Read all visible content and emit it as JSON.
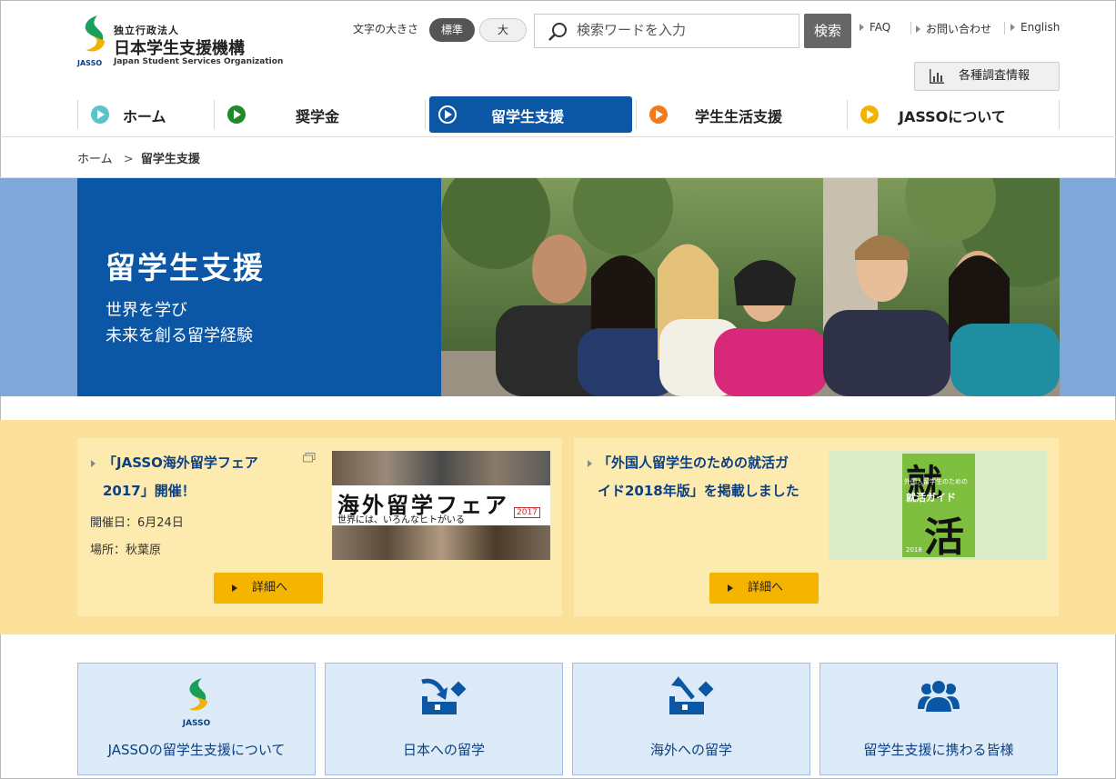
{
  "header": {
    "logo": {
      "line1": "独立行政法人",
      "line2": "日本学生支援機構",
      "line3": "Japan Student Services Organization",
      "mark_text": "JASSO"
    },
    "font_size_label": "文字の大きさ",
    "font_size_normal": "標準",
    "font_size_large": "大",
    "search_placeholder": "検索ワードを入力",
    "search_button": "検索",
    "links": [
      "FAQ",
      "お問い合わせ",
      "English"
    ],
    "survey_button": "各種調査情報"
  },
  "nav": {
    "items": [
      {
        "label": "ホーム",
        "color": "#5bc3c7"
      },
      {
        "label": "奨学金",
        "color": "#1e8a2c"
      },
      {
        "label": "留学生支援",
        "color": "#0c56a6"
      },
      {
        "label": "学生生活支援",
        "color": "#f07a1c"
      },
      {
        "label": "JASSOについて",
        "color": "#f2b200"
      }
    ]
  },
  "breadcrumb": {
    "home": "ホーム",
    "separator": ">",
    "current": "留学生支援"
  },
  "hero": {
    "title": "留学生支援",
    "subtitle_line1": "世界を学び",
    "subtitle_line2": "未来を創る留学経験"
  },
  "news": [
    {
      "title_line1": "「JASSO海外留学フェア",
      "title_line2": "2017」開催！",
      "date": "開催日：6月24日",
      "place": "場所：秋葉原",
      "button": "詳細へ",
      "image_text": "海外留学フェア",
      "image_sub": "世界には、いろんなヒトがいる",
      "image_year": "2017"
    },
    {
      "title_line1": "「外国人留学生のための就活ガ",
      "title_line2": "イド2018年版」を掲載しました",
      "button": "詳細へ",
      "image_big1": "就",
      "image_mid": "就活ガイド",
      "image_big2": "活",
      "image_small": "外国人留学生のための",
      "image_year": "2018"
    }
  ],
  "tiles": [
    {
      "label": "JASSOの留学生支援について",
      "icon": "jasso-logo-icon"
    },
    {
      "label": "日本への留学",
      "icon": "study-in-japan-icon"
    },
    {
      "label": "海外への留学",
      "icon": "study-abroad-icon"
    },
    {
      "label": "留学生支援に携わる皆様",
      "icon": "people-icon"
    }
  ],
  "colors": {
    "primary_blue": "#0c56a6",
    "band_blue": "#7fa8d8",
    "news_band": "#fbe09a",
    "news_card": "#fdeaae",
    "button_yellow": "#f5b400",
    "tile_bg": "#ddeaf8"
  }
}
